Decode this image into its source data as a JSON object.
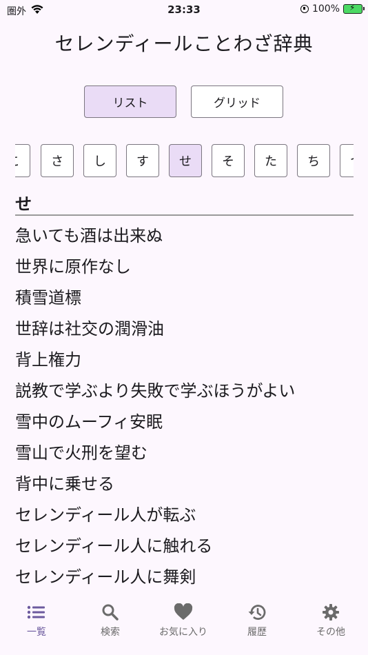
{
  "status": {
    "carrier": "圏外",
    "time": "23:33",
    "battery": "100%"
  },
  "title": "セレンディールことわざ辞典",
  "view_toggle": {
    "list": "リスト",
    "grid": "グリッド"
  },
  "kana": [
    "こ",
    "さ",
    "し",
    "す",
    "せ",
    "そ",
    "た",
    "ち",
    "つ"
  ],
  "selected_kana": "せ",
  "section": "せ",
  "proverbs": [
    "急いても酒は出来ぬ",
    "世界に原作なし",
    "積雪道標",
    "世辞は社交の潤滑油",
    "背上権力",
    "説教で学ぶより失敗で学ぶほうがよい",
    "雪中のムーフィ安眠",
    "雪山で火刑を望む",
    "背中に乗せる",
    "セレンディール人が転ぶ",
    "セレンディール人に触れる",
    "セレンディール人に舞剣"
  ],
  "tabs": [
    {
      "label": "一覧",
      "icon": "list-icon",
      "active": true
    },
    {
      "label": "検索",
      "icon": "search-icon",
      "active": false
    },
    {
      "label": "お気に入り",
      "icon": "heart-icon",
      "active": false
    },
    {
      "label": "履歴",
      "icon": "history-icon",
      "active": false
    },
    {
      "label": "その他",
      "icon": "gear-icon",
      "active": false
    }
  ],
  "colors": {
    "accent": "#6c5a9e",
    "selected_bg": "#eadcf6",
    "background": "#fdf7fe"
  }
}
